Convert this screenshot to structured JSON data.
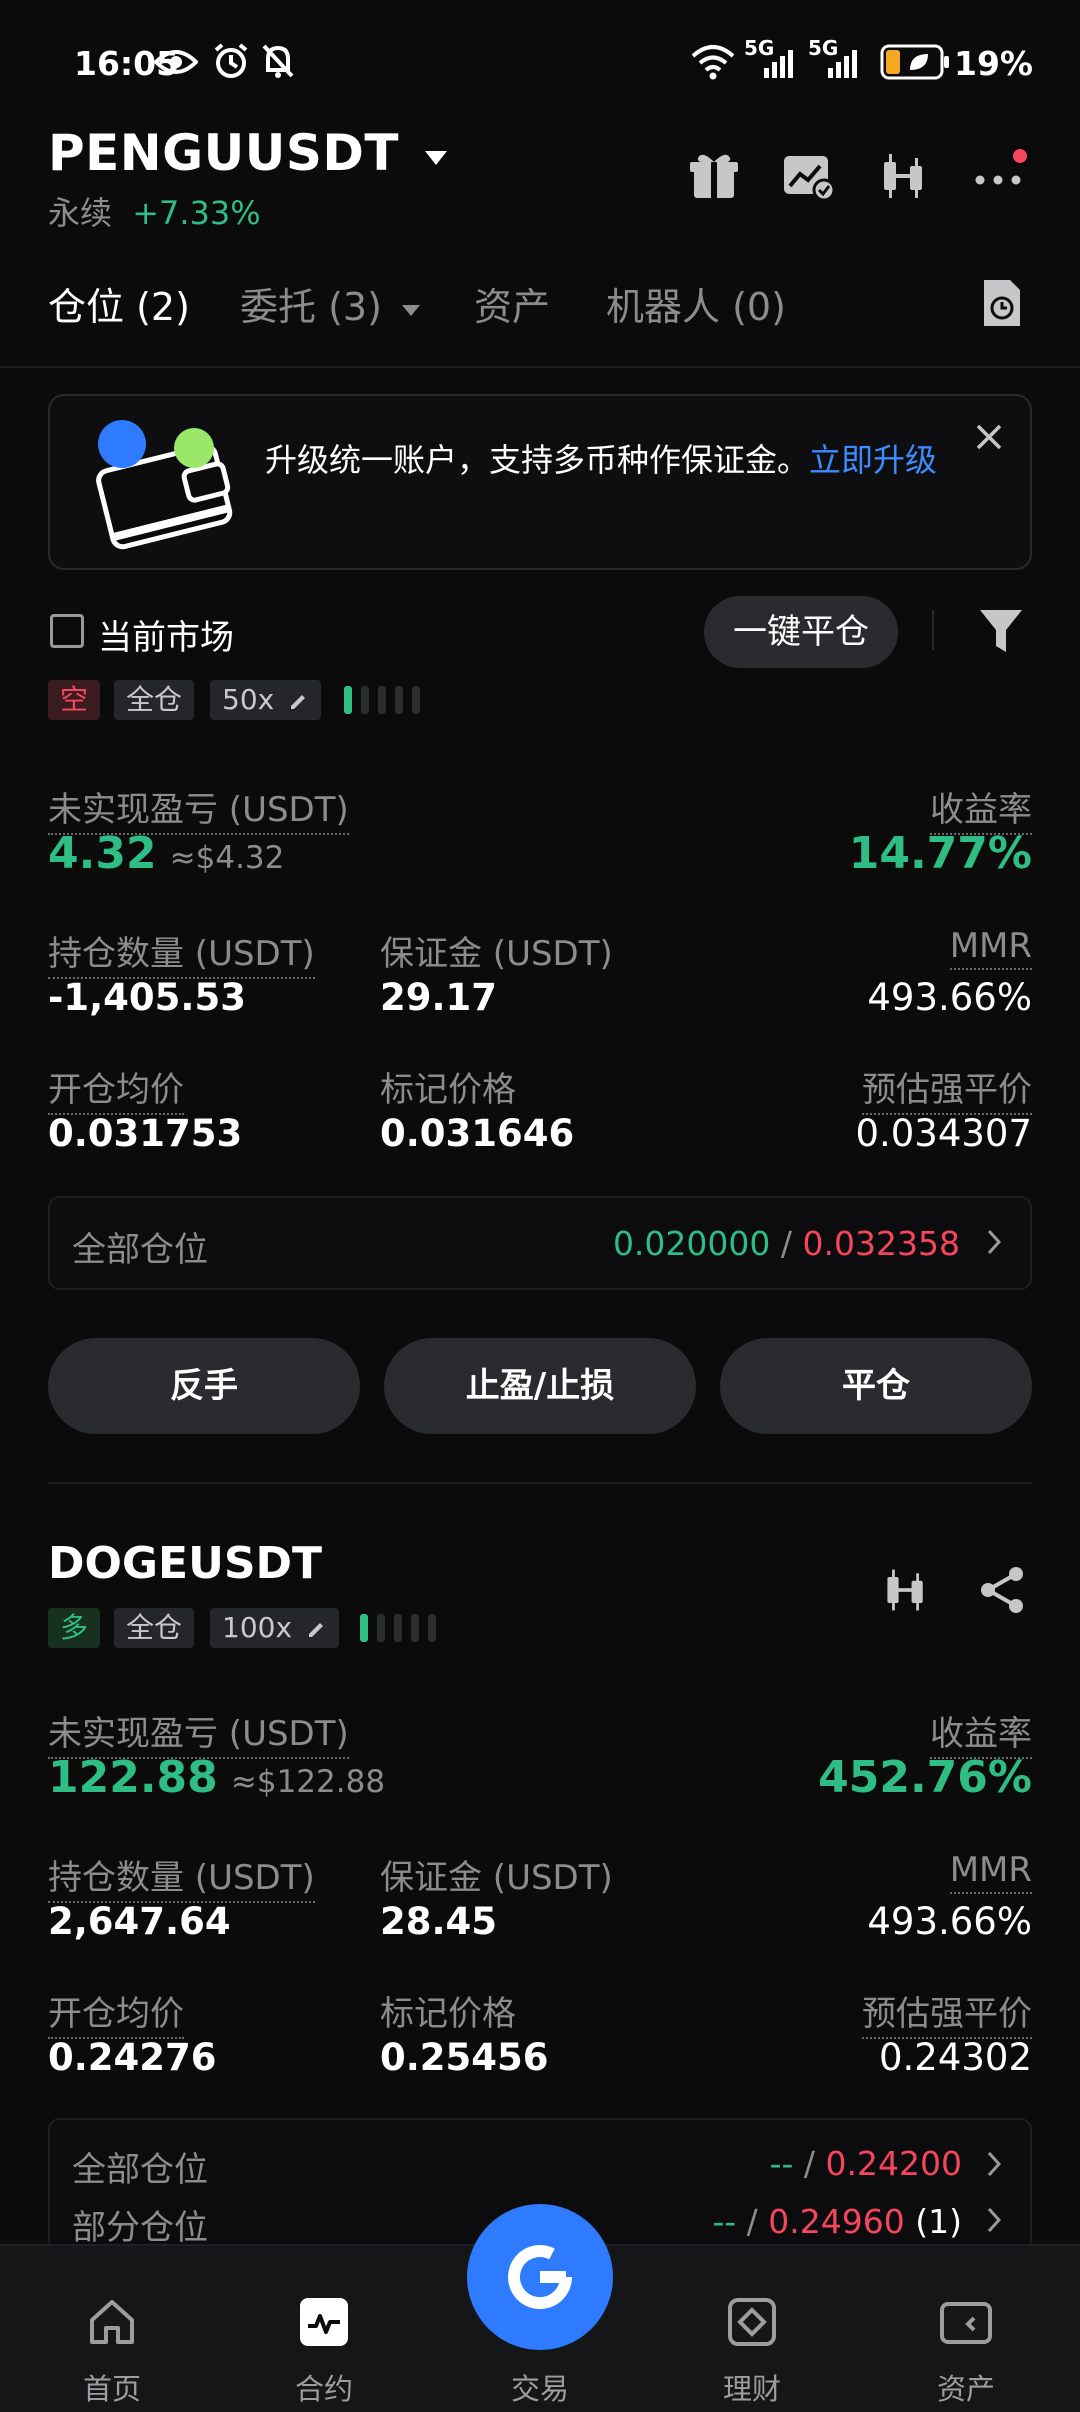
{
  "status_bar": {
    "time": "16:05",
    "battery": "19%",
    "network_1": "5G",
    "network_2": "5G"
  },
  "header": {
    "symbol": "PENGUUSDT",
    "type": "永续",
    "change": "+7.33%"
  },
  "tabs": [
    {
      "label": "仓位 (2)"
    },
    {
      "label": "委托 (3)"
    },
    {
      "label": "资产"
    },
    {
      "label": "机器人 (0)"
    }
  ],
  "banner": {
    "text": "升级统一账户，支持多币种作保证金。",
    "link": "立即升级"
  },
  "filter": {
    "current_market_label": "当前市场",
    "close_all_label": "一键平仓"
  },
  "positions": [
    {
      "side_tag": "空",
      "margin_mode": "全仓",
      "leverage": "50x",
      "leverage_level": 0.2,
      "unrealized_pnl_label": "未实现盈亏 (USDT)",
      "unrealized_pnl": "4.32",
      "unrealized_pnl_usd": "≈$4.32",
      "roe_label": "收益率",
      "roe": "14.77%",
      "size_label": "持仓数量 (USDT)",
      "size": "-1,405.53",
      "margin_label": "保证金 (USDT)",
      "margin": "29.17",
      "mmr_label": "MMR",
      "mmr": "493.66%",
      "entry_label": "开仓均价",
      "entry": "0.031753",
      "mark_label": "标记价格",
      "mark": "0.031646",
      "liq_label": "预估强平价",
      "liq": "0.034307",
      "tpsl_rows": [
        {
          "label": "全部仓位",
          "tp": "0.020000",
          "sep": "/",
          "sl": "0.032358",
          "count": ""
        }
      ],
      "buttons": [
        "反手",
        "止盈/止损",
        "平仓"
      ]
    },
    {
      "symbol": "DOGEUSDT",
      "side_tag": "多",
      "margin_mode": "全仓",
      "leverage": "100x",
      "leverage_level": 0.2,
      "unrealized_pnl_label": "未实现盈亏 (USDT)",
      "unrealized_pnl": "122.88",
      "unrealized_pnl_usd": "≈$122.88",
      "roe_label": "收益率",
      "roe": "452.76%",
      "size_label": "持仓数量 (USDT)",
      "size": "2,647.64",
      "margin_label": "保证金 (USDT)",
      "margin": "28.45",
      "mmr_label": "MMR",
      "mmr": "493.66%",
      "entry_label": "开仓均价",
      "entry": "0.24276",
      "mark_label": "标记价格",
      "mark": "0.25456",
      "liq_label": "预估强平价",
      "liq": "0.24302",
      "tpsl_rows": [
        {
          "label": "全部仓位",
          "tp": "--",
          "sep": "/",
          "sl": "0.24200",
          "count": ""
        },
        {
          "label": "部分仓位",
          "tp": "--",
          "sep": "/",
          "sl": "0.24960",
          "count": "(1)"
        }
      ]
    }
  ],
  "bottom_nav": [
    {
      "label": "首页",
      "icon": "home-icon"
    },
    {
      "label": "合约",
      "icon": "futures-icon"
    },
    {
      "label": "交易",
      "icon": "trade-icon"
    },
    {
      "label": "理财",
      "icon": "earn-icon"
    },
    {
      "label": "资产",
      "icon": "wallet-icon"
    }
  ],
  "colors": {
    "background": "#0b0b0c",
    "profit": "#2ebd85",
    "loss": "#f6465d",
    "liquidation": "#f0a06b",
    "accent": "#2f7bff"
  }
}
